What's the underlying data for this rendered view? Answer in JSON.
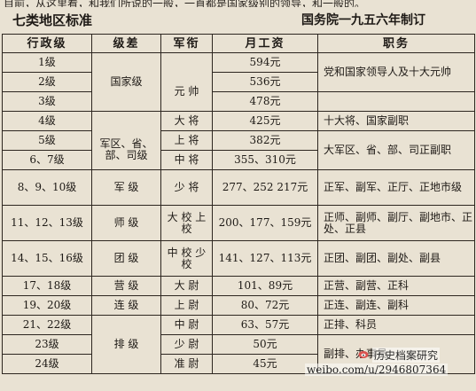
{
  "header": {
    "top_strip": "目前，从这里看，和我们所说的一般，一直都是国家级别的领导，和一般的。",
    "left_title": "七类地区标准",
    "right_title": "国务院一九五六年制订"
  },
  "columns": [
    "行政级",
    "级差",
    "军衔",
    "月工资",
    "职务"
  ],
  "table": {
    "r1_level": "1级",
    "r1_wage": "594元",
    "r2_level": "2级",
    "r2_wage": "536元",
    "r3_level": "3级",
    "r3_wage": "478元",
    "grade_guojia": "国家级",
    "rank_yuanshuai": "元 帅",
    "duty_1": "党和国家领导人及十大元帅",
    "r4_level": "4级",
    "r4_rank": "大 将",
    "r4_wage": "425元",
    "r4_duty": "十大将、国家副职",
    "r5_level": "5级",
    "r5_rank": "上 将",
    "r5_wage": "382元",
    "r6_level": "6、7级",
    "r6_rank": "中 将",
    "r6_wage": "355、310元",
    "grade_junqu": "军区、省、部、司级",
    "duty_5": "大军区、省、部、司正副职",
    "r8_level": "8、9、10级",
    "r8_grade": "军 级",
    "r8_rank": "少 将",
    "r8_wage": "277、252 217元",
    "r8_duty": "正军、副军、正厅、正地市级",
    "r11_level": "11、12、13级",
    "r11_grade": "师 级",
    "r11_rank": "大 校 上 校",
    "r11_wage": "200、177、159元",
    "r11_duty": "正师、副师、副厅、副地市、正处、正县",
    "r14_level": "14、15、16级",
    "r14_grade": "团 级",
    "r14_rank": "中 校 少 校",
    "r14_wage": "141、127、113元",
    "r14_duty": "正团、副团、副处、副县",
    "r17_level": "17、18级",
    "r17_grade": "营 级",
    "r17_rank": "大 尉",
    "r17_wage": "101、89元",
    "r17_duty": "正营、副营、正科",
    "r19_level": "19、20级",
    "r19_grade": "连 级",
    "r19_rank": "上 尉",
    "r19_wage": "80、72元",
    "r19_duty": "正连、副连、副科",
    "r21_level": "21、22级",
    "r21_rank": "中 尉",
    "r21_wage": "63、57元",
    "r21_duty": "正排、科员",
    "r23_level": "23级",
    "r23_rank": "少 尉",
    "r23_wage": "50元",
    "r24_level": "24级",
    "r24_rank": "准 尉",
    "r24_wage": "45元",
    "grade_pai": "排 级",
    "duty_pai_lower": "副排、办事员"
  },
  "watermark": {
    "line1": "历史档案研究",
    "line2": "weibo.com/u/2946807364"
  }
}
